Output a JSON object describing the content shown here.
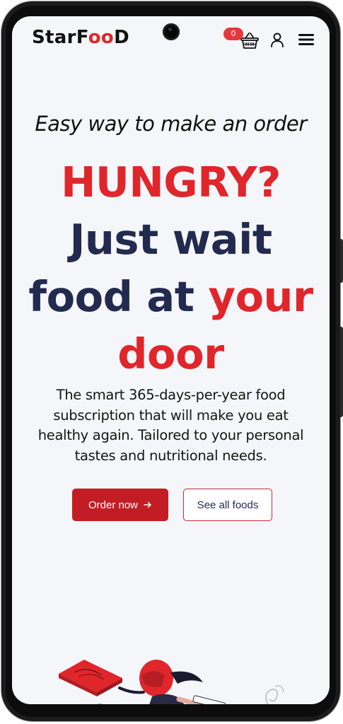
{
  "header": {
    "logo_part1": "StarF",
    "logo_part2": "oo",
    "logo_part3": "D",
    "cart_count": "0",
    "icons": [
      "basket-icon",
      "user-icon",
      "hamburger-menu-icon"
    ]
  },
  "hero": {
    "tagline": "Easy way to make an order",
    "title_line1": "HUNGRY?",
    "title_line2": "Just wait",
    "title_line3_a": "food at ",
    "title_line3_b": "your",
    "title_line4": "door",
    "description": "The smart 365-days-per-year food subscription that will make you eat healthy again. Tailored to your personal tastes and nutritional needs."
  },
  "buttons": {
    "order_label": "Order now",
    "see_all_label": "See all foods"
  },
  "colors": {
    "accent_red": "#e0262b",
    "button_red": "#c21d24",
    "navy": "#232a4f",
    "background": "#f5f6f9"
  }
}
